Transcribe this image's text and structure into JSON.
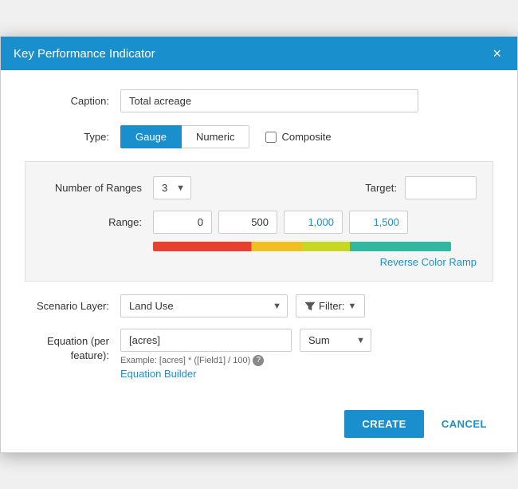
{
  "dialog": {
    "title": "Key Performance Indicator",
    "close_label": "×"
  },
  "form": {
    "caption_label": "Caption:",
    "caption_value": "Total acreage",
    "type_label": "Type:",
    "btn_gauge_label": "Gauge",
    "btn_numeric_label": "Numeric",
    "composite_label": "Composite",
    "number_of_ranges_label": "Number of Ranges",
    "number_of_ranges_value": "3",
    "target_label": "Target:",
    "target_value": "",
    "range_label": "Range:",
    "range_values": [
      "0",
      "500",
      "1,000",
      "1,500"
    ],
    "reverse_color_ramp_label": "Reverse Color Ramp",
    "scenario_layer_label": "Scenario Layer:",
    "scenario_layer_value": "Land Use",
    "filter_label": "Filter:",
    "equation_label": "Equation (per feature):",
    "equation_value": "[acres]",
    "equation_example": "Example: [acres] * ([Field1] / 100)",
    "equation_builder_label": "Equation Builder",
    "sum_value": "Sum"
  },
  "footer": {
    "create_label": "CREATE",
    "cancel_label": "CANCEL"
  }
}
